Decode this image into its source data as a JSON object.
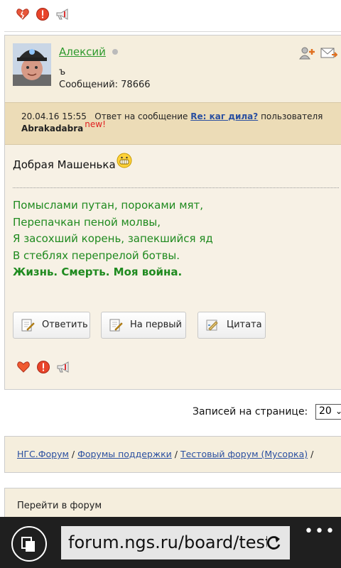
{
  "top_actions": {
    "like_icon": "broken-heart-icon",
    "report_icon": "warning-icon",
    "megaphone_icon": "megaphone-icon"
  },
  "post": {
    "author": {
      "name": "Алексий",
      "status_text": "ъ",
      "messages_label": "Сообщений: 78666",
      "online_icon": "offline-dot-icon"
    },
    "reply_info": {
      "datetime": "20.04.16 15:55",
      "reply_prefix": "Ответ на сообщение",
      "reply_link": "Re: каг дила?",
      "user_prefix": "пользователя",
      "username": "Abrakadabra",
      "new_badge": "new!"
    },
    "greeting": "Добрая Машенька",
    "poem": [
      "Помыслами путан, пороками мят,",
      "Перепачкан пеной молвы,",
      "Я засохший корень, запекшийся яд",
      "В стеблях перепрелой ботвы."
    ],
    "poem_bold": "Жизнь. Смерть. Моя война.",
    "buttons": {
      "reply": "Ответить",
      "first": "На первый",
      "quote": "Цитата"
    }
  },
  "per_page": {
    "label": "Записей на странице:",
    "value": "20"
  },
  "breadcrumb": {
    "items": [
      "НГС.Форум",
      "Форумы поддержки",
      "Тестовый форум (Мусорка)"
    ],
    "sep": "/"
  },
  "jump": {
    "label": "Перейти в форум"
  },
  "browser": {
    "url": "forum.ngs.ru/board/test/",
    "more": "•••"
  },
  "colors": {
    "accent_green": "#2e9a2e",
    "link_blue": "#2a4fa0",
    "post_bg": "#f7f1e5",
    "reply_bg": "#ecdcb7"
  }
}
